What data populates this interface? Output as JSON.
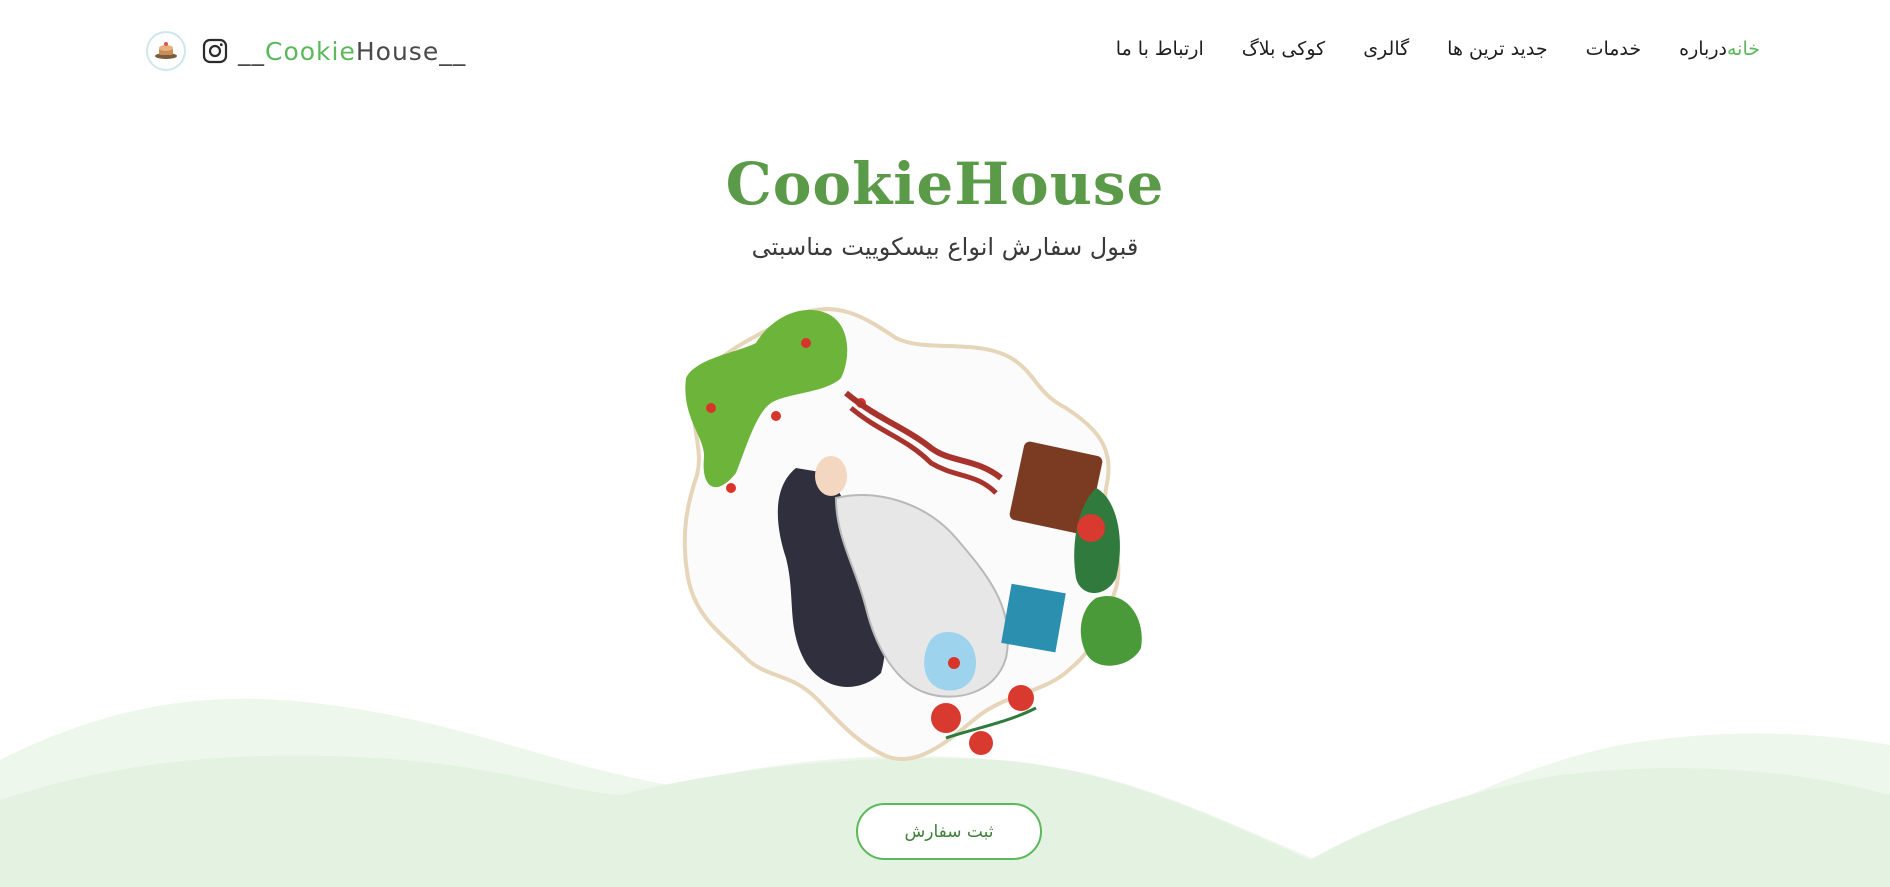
{
  "brand": {
    "prefix": "__",
    "highlight": "Cookie",
    "rest": "House__",
    "logo_icon": "cookie-logo-icon",
    "social_icon": "instagram-icon"
  },
  "nav": {
    "items": [
      {
        "label": "ارتباط با ما",
        "active": false
      },
      {
        "label": "کوکی بلاگ",
        "active": false
      },
      {
        "label": "گالری",
        "active": false
      },
      {
        "label": "جدید ترین ها",
        "active": false
      },
      {
        "label": "خدمات",
        "active": false
      },
      {
        "label": "درباره",
        "active": false
      },
      {
        "label": "خانه",
        "active": true
      }
    ]
  },
  "hero": {
    "title": "CookieHouse",
    "subtitle": "قبول سفارش انواع بیسکوییت مناسبتی",
    "cta_label": "ثبت سفارش"
  },
  "colors": {
    "accent": "#5cb85c",
    "title": "#5a9a48",
    "wave_light": "#eef7ec",
    "wave_mid": "#e4f3e1"
  }
}
